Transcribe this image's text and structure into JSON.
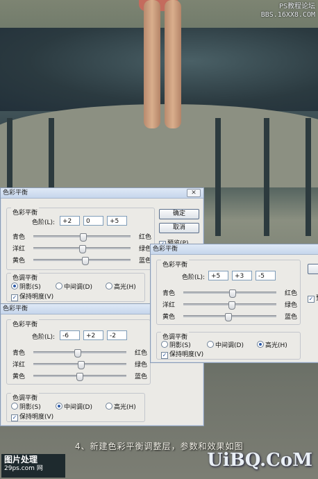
{
  "watermarks": {
    "top_right_line1": "PS教程论坛",
    "top_right_line2": "BBS.16XX8.COM",
    "bottom_right": "UiBQ.CoM",
    "bottom_left_line1": "图片处理",
    "bottom_left_line2": "29ps.com",
    "bottom_left_line3": "网"
  },
  "caption": "4、新建色彩平衡调整层，参数和效果如图",
  "dialog_shadows": {
    "title": "色彩平衡",
    "close_label": "✕",
    "group_balance": "色彩平衡",
    "levels_label": "色阶(L):",
    "levels": [
      "+2",
      "0",
      "+5"
    ],
    "sliders": [
      {
        "left": "青色",
        "right": "红色",
        "value": 2
      },
      {
        "left": "洋红",
        "right": "绿色",
        "value": 0
      },
      {
        "left": "黄色",
        "right": "蓝色",
        "value": 5
      }
    ],
    "group_tone": "色调平衡",
    "tones": [
      "阴影(S)",
      "中间调(D)",
      "高光(H)"
    ],
    "selected_tone": 0,
    "preserve": "保持明度(V)",
    "ok": "确定",
    "cancel": "取消",
    "preview": "预览(P)"
  },
  "dialog_midtones": {
    "title": "色彩平衡",
    "group_balance": "色彩平衡",
    "levels_label": "色阶(L):",
    "levels": [
      "-6",
      "+2",
      "-2"
    ],
    "sliders": [
      {
        "left": "青色",
        "right": "红色",
        "value": -6
      },
      {
        "left": "洋红",
        "right": "绿色",
        "value": 2
      },
      {
        "left": "黄色",
        "right": "蓝色",
        "value": -2
      }
    ],
    "group_tone": "色调平衡",
    "tones": [
      "阴影(S)",
      "中间调(D)",
      "高光(H)"
    ],
    "selected_tone": 1,
    "preserve": "保持明度(V)"
  },
  "dialog_highlights": {
    "title": "色彩平衡",
    "group_balance": "色彩平衡",
    "levels_label": "色阶(L):",
    "levels": [
      "+5",
      "+3",
      "-5"
    ],
    "sliders": [
      {
        "left": "青色",
        "right": "红色",
        "value": 5
      },
      {
        "left": "洋红",
        "right": "绿色",
        "value": 3
      },
      {
        "left": "黄色",
        "right": "蓝色",
        "value": -5
      }
    ],
    "group_tone": "色调平衡",
    "tones": [
      "阴影(S)",
      "中间调(D)",
      "高光(H)"
    ],
    "selected_tone": 2,
    "preserve": "保持明度(V)",
    "preview_partial": "预"
  }
}
